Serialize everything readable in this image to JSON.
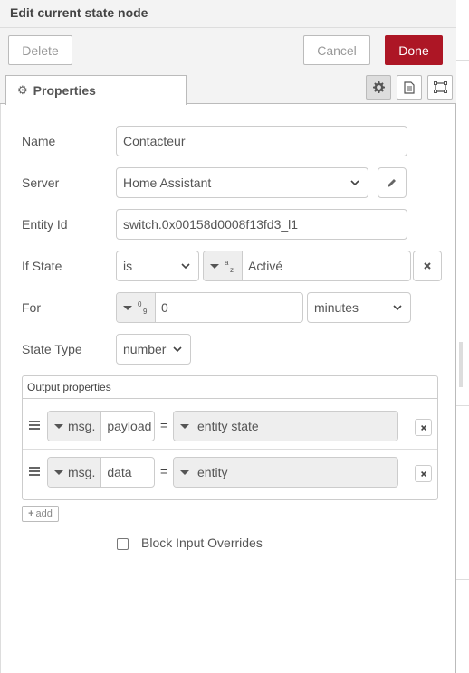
{
  "dialog": {
    "title": "Edit current state node"
  },
  "toolbar": {
    "delete_label": "Delete",
    "cancel_label": "Cancel",
    "done_label": "Done"
  },
  "tabs": {
    "properties_label": "Properties"
  },
  "form": {
    "name": {
      "label": "Name",
      "value": "Contacteur"
    },
    "server": {
      "label": "Server",
      "value": "Home Assistant"
    },
    "entity_id": {
      "label": "Entity Id",
      "value": "switch.0x00158d0008f13fd3_l1"
    },
    "if_state": {
      "label": "If State",
      "operator": "is",
      "type_glyph": "a z",
      "value": "Activé"
    },
    "for": {
      "label": "For",
      "type_glyph": "0 9",
      "value": "0",
      "unit": "minutes"
    },
    "state_type": {
      "label": "State Type",
      "value": "number"
    }
  },
  "output_properties": {
    "title": "Output properties",
    "rows": [
      {
        "prefix": "msg.",
        "property": "payload",
        "equals": "=",
        "value": "entity state"
      },
      {
        "prefix": "msg.",
        "property": "data",
        "equals": "=",
        "value": "entity"
      }
    ],
    "add_label": "add"
  },
  "block_input_overrides": {
    "label": "Block Input Overrides",
    "checked": false
  },
  "colors": {
    "primary": "#ad1625",
    "border": "#cccccc",
    "panel": "#f3f3f3"
  }
}
